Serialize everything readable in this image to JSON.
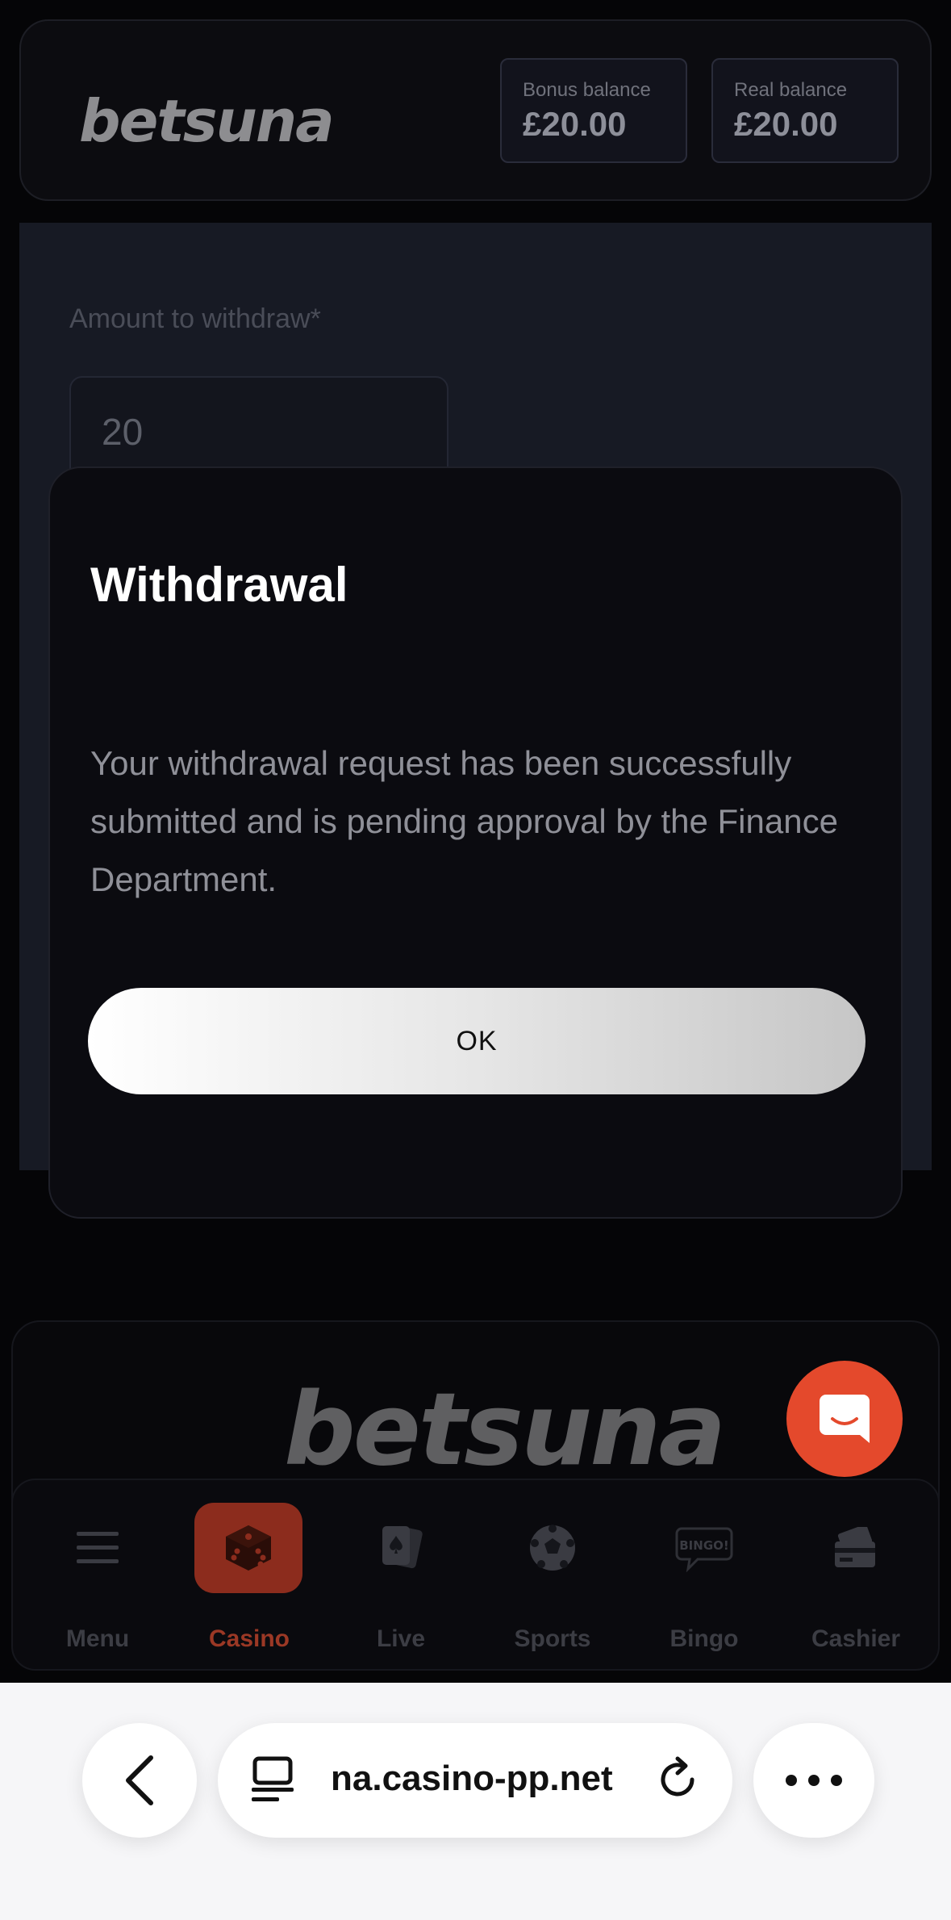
{
  "header": {
    "logo": "betsuna",
    "bonus_balance": {
      "label": "Bonus balance",
      "value": "£20.00"
    },
    "real_balance": {
      "label": "Real balance",
      "value": "£20.00"
    }
  },
  "form": {
    "amount_label": "Amount to withdraw*",
    "amount_value": "20"
  },
  "modal": {
    "title": "Withdrawal",
    "message": "Your withdrawal request has been successfully submitted and is pending approval by the Finance Department.",
    "ok_label": "OK"
  },
  "footer": {
    "logo": "betsuna"
  },
  "bottom_nav": {
    "items": [
      {
        "label": "Menu",
        "icon": "menu-icon"
      },
      {
        "label": "Casino",
        "icon": "dice-icon",
        "active": true
      },
      {
        "label": "Live",
        "icon": "cards-icon"
      },
      {
        "label": "Sports",
        "icon": "soccer-ball-icon"
      },
      {
        "label": "Bingo",
        "icon": "bingo-icon"
      },
      {
        "label": "Cashier",
        "icon": "cashier-icon"
      }
    ]
  },
  "browser": {
    "url": "na.casino-pp.net"
  },
  "colors": {
    "accent": "#e4492c",
    "modal_bg": "#0b0b10",
    "page_bg": "#050507"
  }
}
